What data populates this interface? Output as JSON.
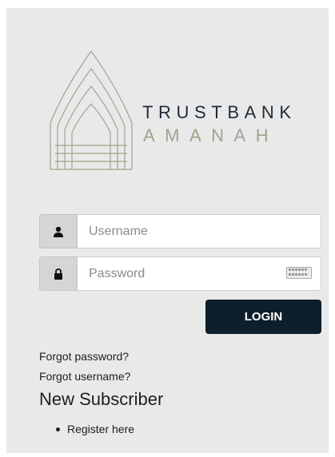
{
  "brand": {
    "line1": "TRUSTBANK",
    "line2": "AMANAH",
    "colors": {
      "primary": "#1f2b36",
      "gold": "#a6a18c"
    }
  },
  "login_form": {
    "username": {
      "placeholder": "Username",
      "value": "",
      "icon": "user-icon"
    },
    "password": {
      "placeholder": "Password",
      "value": "",
      "icon": "lock-icon",
      "keyboard_icon": "virtual-keyboard-icon"
    },
    "login_label": "LOGIN",
    "login_color": "#0e1e2b"
  },
  "links": {
    "forgot_password": "Forgot password?",
    "forgot_username": "Forgot username?"
  },
  "subscriber": {
    "heading": "New Subscriber",
    "register_label": "Register here"
  },
  "panel_background": "#e9e9ea"
}
